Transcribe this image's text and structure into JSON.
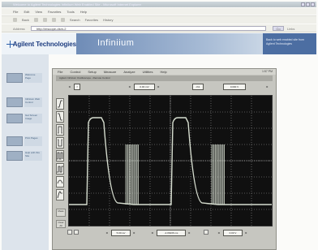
{
  "browser": {
    "title": "Welcome to Agilent Technologies Infiniium Web Enabled Site - Microsoft Internet Explorer",
    "menu": [
      "File",
      "Edit",
      "View",
      "Favorites",
      "Tools",
      "Help"
    ],
    "toolbar": [
      "Back",
      "Forward",
      "Stop",
      "Refresh",
      "Home",
      "Search",
      "Favorites",
      "History"
    ],
    "address_label": "Address",
    "address_value": "http://mscope-dsm-2",
    "go_label": "Go",
    "links_label": "Links"
  },
  "banner": {
    "company": "Agilent Technologies",
    "product": "Infiniium",
    "note": "Back to web enabled site from Agilent Technologies"
  },
  "nav": [
    {
      "label": "Welcome Page"
    },
    {
      "label": "Infiniium Web Control"
    },
    {
      "label": "Get Screen Image"
    },
    {
      "label": "Print Pages"
    },
    {
      "label": "Help with this Site"
    }
  ],
  "scope": {
    "menu": [
      "File",
      "Control",
      "Setup",
      "Measure",
      "Analyze",
      "Utilities",
      "Help"
    ],
    "time": "1:57 PM",
    "status": "Agilent Infiniium Oscilloscope - Remote Control",
    "top_ctrl_a": "f",
    "top_ctrl_b": "0.00 mV",
    "top_ctrl_c": "ch1",
    "top_ctrl_d": "0.000 V",
    "bottom_ctrl_a": "5.00 ns/",
    "bottom_ctrl_b": "-2.06436 ms",
    "bottom_ctrl_c": "0.00 V",
    "side_buttons": [
      "Meas",
      "Clear All"
    ]
  },
  "colors": {
    "waveform": "#d6ddcf",
    "grid": "#bfbfbf",
    "screen_bg": "#101010"
  }
}
